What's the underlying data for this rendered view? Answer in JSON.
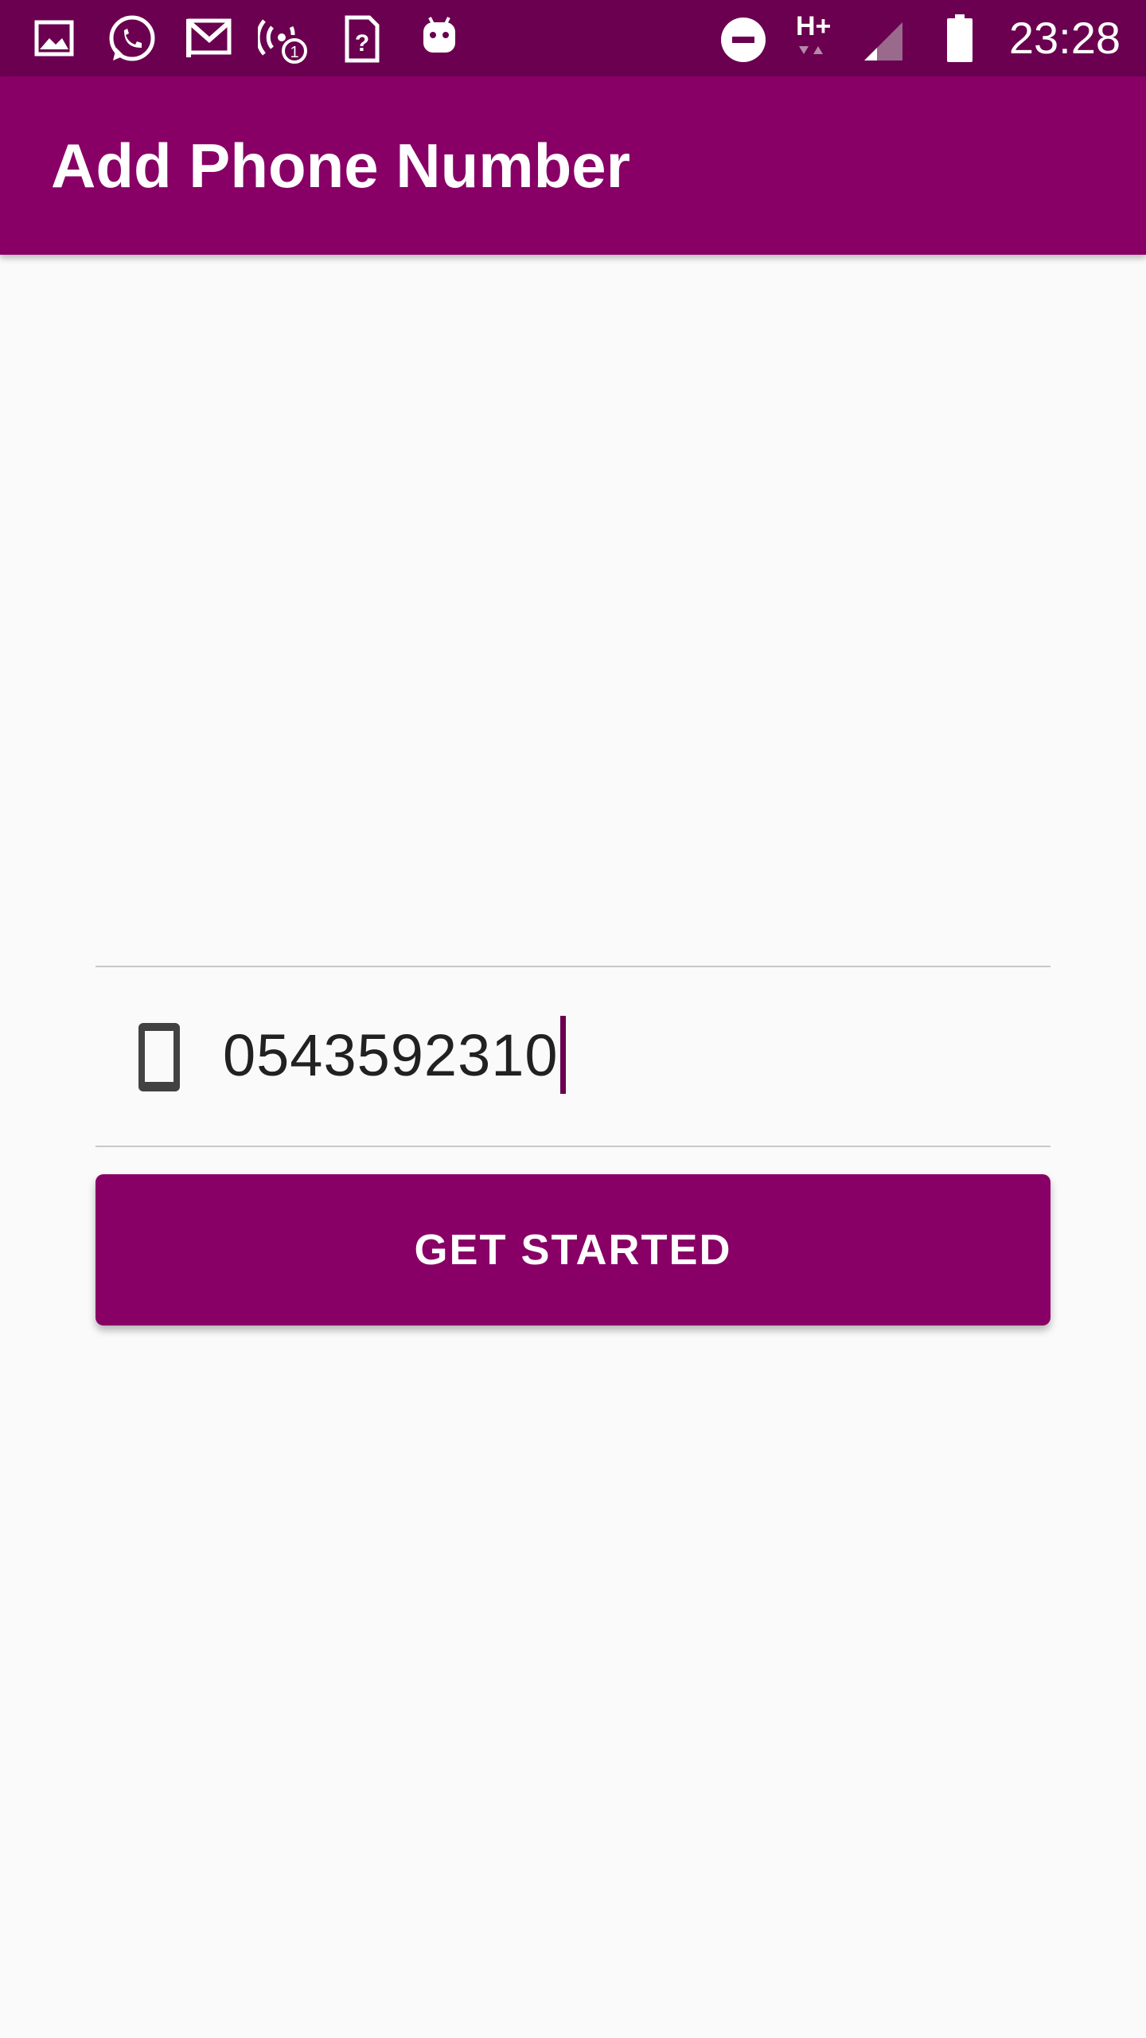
{
  "status_bar": {
    "time": "23:28",
    "left_icons": [
      "image-icon",
      "whatsapp-icon",
      "gmail-icon",
      "hotspot-icon",
      "sim-unknown-icon",
      "android-icon"
    ],
    "right_icons": [
      "do-not-disturb-icon",
      "network-hplus-icon",
      "signal-icon",
      "battery-icon"
    ],
    "network_label": "H+"
  },
  "app_bar": {
    "title": "Add Phone Number"
  },
  "form": {
    "phone_value": "0543592310",
    "button_label": "GET STARTED",
    "icon": "smartphone-icon"
  },
  "colors": {
    "status_bar": "#6a004f",
    "primary": "#880066",
    "background": "#fafafa",
    "text": "#212121",
    "divider": "#c8c8c8"
  }
}
